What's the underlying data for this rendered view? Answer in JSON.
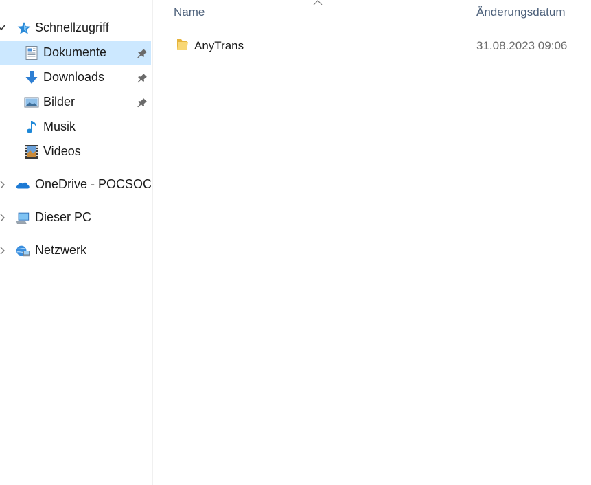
{
  "navigation": {
    "quick_access": {
      "label": "Schnellzugriff",
      "items": [
        {
          "label": "Dokumente",
          "pinned": true,
          "selected": true
        },
        {
          "label": "Downloads",
          "pinned": true,
          "selected": false
        },
        {
          "label": "Bilder",
          "pinned": true,
          "selected": false
        },
        {
          "label": "Musik",
          "pinned": false,
          "selected": false
        },
        {
          "label": "Videos",
          "pinned": false,
          "selected": false
        }
      ]
    },
    "onedrive": {
      "label": "OneDrive - POCSOCL"
    },
    "this_pc": {
      "label": "Dieser PC"
    },
    "network": {
      "label": "Netzwerk"
    }
  },
  "file_list": {
    "columns": {
      "name": "Name",
      "date_modified": "Änderungsdatum"
    },
    "rows": [
      {
        "name": "AnyTrans",
        "date_modified": "31.08.2023 09:06",
        "type": "folder"
      }
    ]
  },
  "colors": {
    "selection": "#cce8ff",
    "header_text": "#4c607a",
    "date_text": "#6d6d6d"
  },
  "icons": {
    "quick_access": "star-icon",
    "documents": "document-icon",
    "downloads": "download-arrow-icon",
    "pictures": "picture-icon",
    "music": "music-note-icon",
    "videos": "film-icon",
    "onedrive": "cloud-icon",
    "this_pc": "computer-icon",
    "network": "network-icon",
    "pin": "pin-icon",
    "folder": "folder-icon"
  }
}
